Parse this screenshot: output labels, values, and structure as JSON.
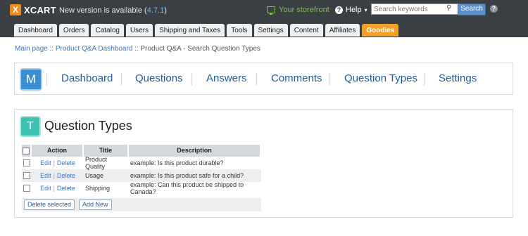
{
  "header": {
    "logo_mark": "X",
    "logo_text": "XCART",
    "new_version_prefix": "New version is available (",
    "new_version_number": "4.7.1",
    "new_version_suffix": ")",
    "storefront_label": "Your storefront",
    "help_label": "Help",
    "help_glyph": "?",
    "search_placeholder": "Search keywords",
    "search_button": "Search",
    "info_glyph": "?"
  },
  "tabs": [
    {
      "label": "Dashboard"
    },
    {
      "label": "Orders"
    },
    {
      "label": "Catalog"
    },
    {
      "label": "Users"
    },
    {
      "label": "Shipping and Taxes"
    },
    {
      "label": "Tools"
    },
    {
      "label": "Settings"
    },
    {
      "label": "Content"
    },
    {
      "label": "Affiliates"
    },
    {
      "label": "Goodies"
    }
  ],
  "breadcrumb": {
    "items": [
      {
        "label": "Main page"
      },
      {
        "label": "Product Q&A Dashboard"
      },
      {
        "label": "Product Q&A - Search Question Types"
      }
    ],
    "separator": " :: "
  },
  "module_nav": {
    "badge": "M",
    "items": [
      {
        "label": "Dashboard"
      },
      {
        "label": "Questions"
      },
      {
        "label": "Answers"
      },
      {
        "label": "Comments"
      },
      {
        "label": "Question Types"
      },
      {
        "label": "Settings"
      }
    ]
  },
  "panel": {
    "badge": "T",
    "title": "Question Types"
  },
  "table": {
    "columns": [
      "Action",
      "Title",
      "Description"
    ],
    "edit_label": "Edit",
    "delete_label": "Delete",
    "rows": [
      {
        "title": "Product Quality",
        "description": "example: Is this product durable?"
      },
      {
        "title": "Usage",
        "description": "example: Is this product safe for a child?"
      },
      {
        "title": "Shipping",
        "description": "example: Can this product be shipped to Canada?"
      }
    ]
  },
  "buttons": {
    "delete_selected": "Delete selected",
    "add_new": "Add New"
  },
  "colors": {
    "topbar": "#3a3f44",
    "accent_orange": "#f4a12a",
    "link_blue": "#3d78b6",
    "storefront_green": "#7fc241",
    "m_badge": "#3b8ed0",
    "t_badge": "#3ec1b3"
  }
}
